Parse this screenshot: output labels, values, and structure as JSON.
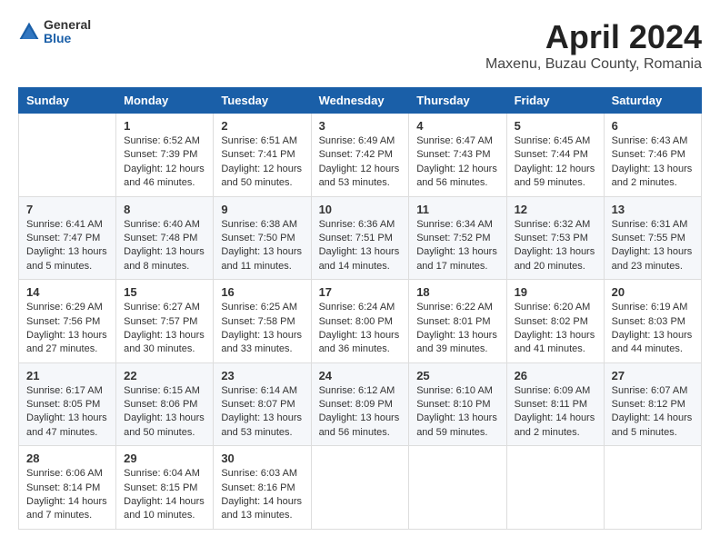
{
  "header": {
    "logo_general": "General",
    "logo_blue": "Blue",
    "title": "April 2024",
    "location": "Maxenu, Buzau County, Romania"
  },
  "columns": [
    "Sunday",
    "Monday",
    "Tuesday",
    "Wednesday",
    "Thursday",
    "Friday",
    "Saturday"
  ],
  "weeks": [
    [
      {
        "day": "",
        "sunrise": "",
        "sunset": "",
        "daylight": ""
      },
      {
        "day": "1",
        "sunrise": "Sunrise: 6:52 AM",
        "sunset": "Sunset: 7:39 PM",
        "daylight": "Daylight: 12 hours and 46 minutes."
      },
      {
        "day": "2",
        "sunrise": "Sunrise: 6:51 AM",
        "sunset": "Sunset: 7:41 PM",
        "daylight": "Daylight: 12 hours and 50 minutes."
      },
      {
        "day": "3",
        "sunrise": "Sunrise: 6:49 AM",
        "sunset": "Sunset: 7:42 PM",
        "daylight": "Daylight: 12 hours and 53 minutes."
      },
      {
        "day": "4",
        "sunrise": "Sunrise: 6:47 AM",
        "sunset": "Sunset: 7:43 PM",
        "daylight": "Daylight: 12 hours and 56 minutes."
      },
      {
        "day": "5",
        "sunrise": "Sunrise: 6:45 AM",
        "sunset": "Sunset: 7:44 PM",
        "daylight": "Daylight: 12 hours and 59 minutes."
      },
      {
        "day": "6",
        "sunrise": "Sunrise: 6:43 AM",
        "sunset": "Sunset: 7:46 PM",
        "daylight": "Daylight: 13 hours and 2 minutes."
      }
    ],
    [
      {
        "day": "7",
        "sunrise": "Sunrise: 6:41 AM",
        "sunset": "Sunset: 7:47 PM",
        "daylight": "Daylight: 13 hours and 5 minutes."
      },
      {
        "day": "8",
        "sunrise": "Sunrise: 6:40 AM",
        "sunset": "Sunset: 7:48 PM",
        "daylight": "Daylight: 13 hours and 8 minutes."
      },
      {
        "day": "9",
        "sunrise": "Sunrise: 6:38 AM",
        "sunset": "Sunset: 7:50 PM",
        "daylight": "Daylight: 13 hours and 11 minutes."
      },
      {
        "day": "10",
        "sunrise": "Sunrise: 6:36 AM",
        "sunset": "Sunset: 7:51 PM",
        "daylight": "Daylight: 13 hours and 14 minutes."
      },
      {
        "day": "11",
        "sunrise": "Sunrise: 6:34 AM",
        "sunset": "Sunset: 7:52 PM",
        "daylight": "Daylight: 13 hours and 17 minutes."
      },
      {
        "day": "12",
        "sunrise": "Sunrise: 6:32 AM",
        "sunset": "Sunset: 7:53 PM",
        "daylight": "Daylight: 13 hours and 20 minutes."
      },
      {
        "day": "13",
        "sunrise": "Sunrise: 6:31 AM",
        "sunset": "Sunset: 7:55 PM",
        "daylight": "Daylight: 13 hours and 23 minutes."
      }
    ],
    [
      {
        "day": "14",
        "sunrise": "Sunrise: 6:29 AM",
        "sunset": "Sunset: 7:56 PM",
        "daylight": "Daylight: 13 hours and 27 minutes."
      },
      {
        "day": "15",
        "sunrise": "Sunrise: 6:27 AM",
        "sunset": "Sunset: 7:57 PM",
        "daylight": "Daylight: 13 hours and 30 minutes."
      },
      {
        "day": "16",
        "sunrise": "Sunrise: 6:25 AM",
        "sunset": "Sunset: 7:58 PM",
        "daylight": "Daylight: 13 hours and 33 minutes."
      },
      {
        "day": "17",
        "sunrise": "Sunrise: 6:24 AM",
        "sunset": "Sunset: 8:00 PM",
        "daylight": "Daylight: 13 hours and 36 minutes."
      },
      {
        "day": "18",
        "sunrise": "Sunrise: 6:22 AM",
        "sunset": "Sunset: 8:01 PM",
        "daylight": "Daylight: 13 hours and 39 minutes."
      },
      {
        "day": "19",
        "sunrise": "Sunrise: 6:20 AM",
        "sunset": "Sunset: 8:02 PM",
        "daylight": "Daylight: 13 hours and 41 minutes."
      },
      {
        "day": "20",
        "sunrise": "Sunrise: 6:19 AM",
        "sunset": "Sunset: 8:03 PM",
        "daylight": "Daylight: 13 hours and 44 minutes."
      }
    ],
    [
      {
        "day": "21",
        "sunrise": "Sunrise: 6:17 AM",
        "sunset": "Sunset: 8:05 PM",
        "daylight": "Daylight: 13 hours and 47 minutes."
      },
      {
        "day": "22",
        "sunrise": "Sunrise: 6:15 AM",
        "sunset": "Sunset: 8:06 PM",
        "daylight": "Daylight: 13 hours and 50 minutes."
      },
      {
        "day": "23",
        "sunrise": "Sunrise: 6:14 AM",
        "sunset": "Sunset: 8:07 PM",
        "daylight": "Daylight: 13 hours and 53 minutes."
      },
      {
        "day": "24",
        "sunrise": "Sunrise: 6:12 AM",
        "sunset": "Sunset: 8:09 PM",
        "daylight": "Daylight: 13 hours and 56 minutes."
      },
      {
        "day": "25",
        "sunrise": "Sunrise: 6:10 AM",
        "sunset": "Sunset: 8:10 PM",
        "daylight": "Daylight: 13 hours and 59 minutes."
      },
      {
        "day": "26",
        "sunrise": "Sunrise: 6:09 AM",
        "sunset": "Sunset: 8:11 PM",
        "daylight": "Daylight: 14 hours and 2 minutes."
      },
      {
        "day": "27",
        "sunrise": "Sunrise: 6:07 AM",
        "sunset": "Sunset: 8:12 PM",
        "daylight": "Daylight: 14 hours and 5 minutes."
      }
    ],
    [
      {
        "day": "28",
        "sunrise": "Sunrise: 6:06 AM",
        "sunset": "Sunset: 8:14 PM",
        "daylight": "Daylight: 14 hours and 7 minutes."
      },
      {
        "day": "29",
        "sunrise": "Sunrise: 6:04 AM",
        "sunset": "Sunset: 8:15 PM",
        "daylight": "Daylight: 14 hours and 10 minutes."
      },
      {
        "day": "30",
        "sunrise": "Sunrise: 6:03 AM",
        "sunset": "Sunset: 8:16 PM",
        "daylight": "Daylight: 14 hours and 13 minutes."
      },
      {
        "day": "",
        "sunrise": "",
        "sunset": "",
        "daylight": ""
      },
      {
        "day": "",
        "sunrise": "",
        "sunset": "",
        "daylight": ""
      },
      {
        "day": "",
        "sunrise": "",
        "sunset": "",
        "daylight": ""
      },
      {
        "day": "",
        "sunrise": "",
        "sunset": "",
        "daylight": ""
      }
    ]
  ]
}
